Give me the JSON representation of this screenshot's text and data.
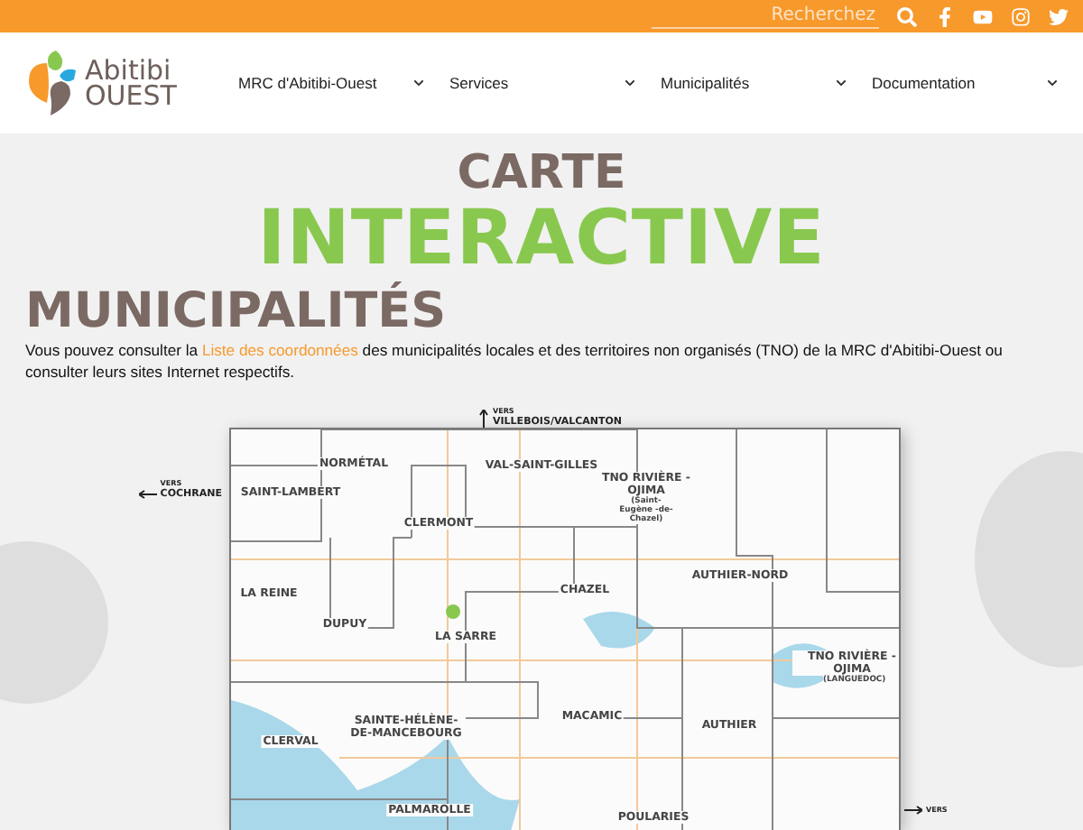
{
  "topbar": {
    "search": {
      "placeholder": "Recherchez"
    }
  },
  "header": {
    "logo": {
      "line1": "Abitibi",
      "line2": "OUEST"
    },
    "nav": [
      {
        "label": "MRC d'Abitibi-Ouest"
      },
      {
        "label": "Services"
      },
      {
        "label": "Municipalités"
      },
      {
        "label": "Documentation"
      }
    ]
  },
  "hero": {
    "title_top": "CARTE",
    "title_main": "INTERACTIVE"
  },
  "section": {
    "heading": "MUNICIPALITÉS",
    "intro_before": "Vous pouvez consulter la ",
    "intro_link": "Liste des coordonnées",
    "intro_after": " des municipalités locales et des territoires non organisés (TNO) de la MRC d'Abitibi-Ouest ou consulter leurs sites Internet respectifs."
  },
  "map": {
    "directions": [
      {
        "kind": "up",
        "small": "VERS",
        "text": "VILLEBOIS/VALCANTON"
      },
      {
        "kind": "left",
        "small": "VERS",
        "text": "COCHRANE"
      },
      {
        "kind": "right",
        "small": "VERS"
      }
    ],
    "labels": [
      {
        "name": "NORMÉTAL"
      },
      {
        "name": "SAINT-LAMBERT"
      },
      {
        "name": "VAL-SAINT-GILLES"
      },
      {
        "name": "TNO RIVIÈRE -OJIMA",
        "sub": "(Saint-Eugène -de-Chazel)"
      },
      {
        "name": "CLERMONT"
      },
      {
        "name": "LA REINE"
      },
      {
        "name": "CHAZEL"
      },
      {
        "name": "AUTHIER-NORD"
      },
      {
        "name": "DUPUY"
      },
      {
        "name": "LA SARRE"
      },
      {
        "name": "TNO RIVIÈRE -OJIMA",
        "sub": "(LANGUEDOC)"
      },
      {
        "name": "SAINTE-HÉLÈNE- DE-MANCEBOURG"
      },
      {
        "name": "MACAMIC"
      },
      {
        "name": "AUTHIER"
      },
      {
        "name": "CLERVAL"
      },
      {
        "name": "PALMAROLLE"
      },
      {
        "name": "POULARIES"
      }
    ]
  }
}
